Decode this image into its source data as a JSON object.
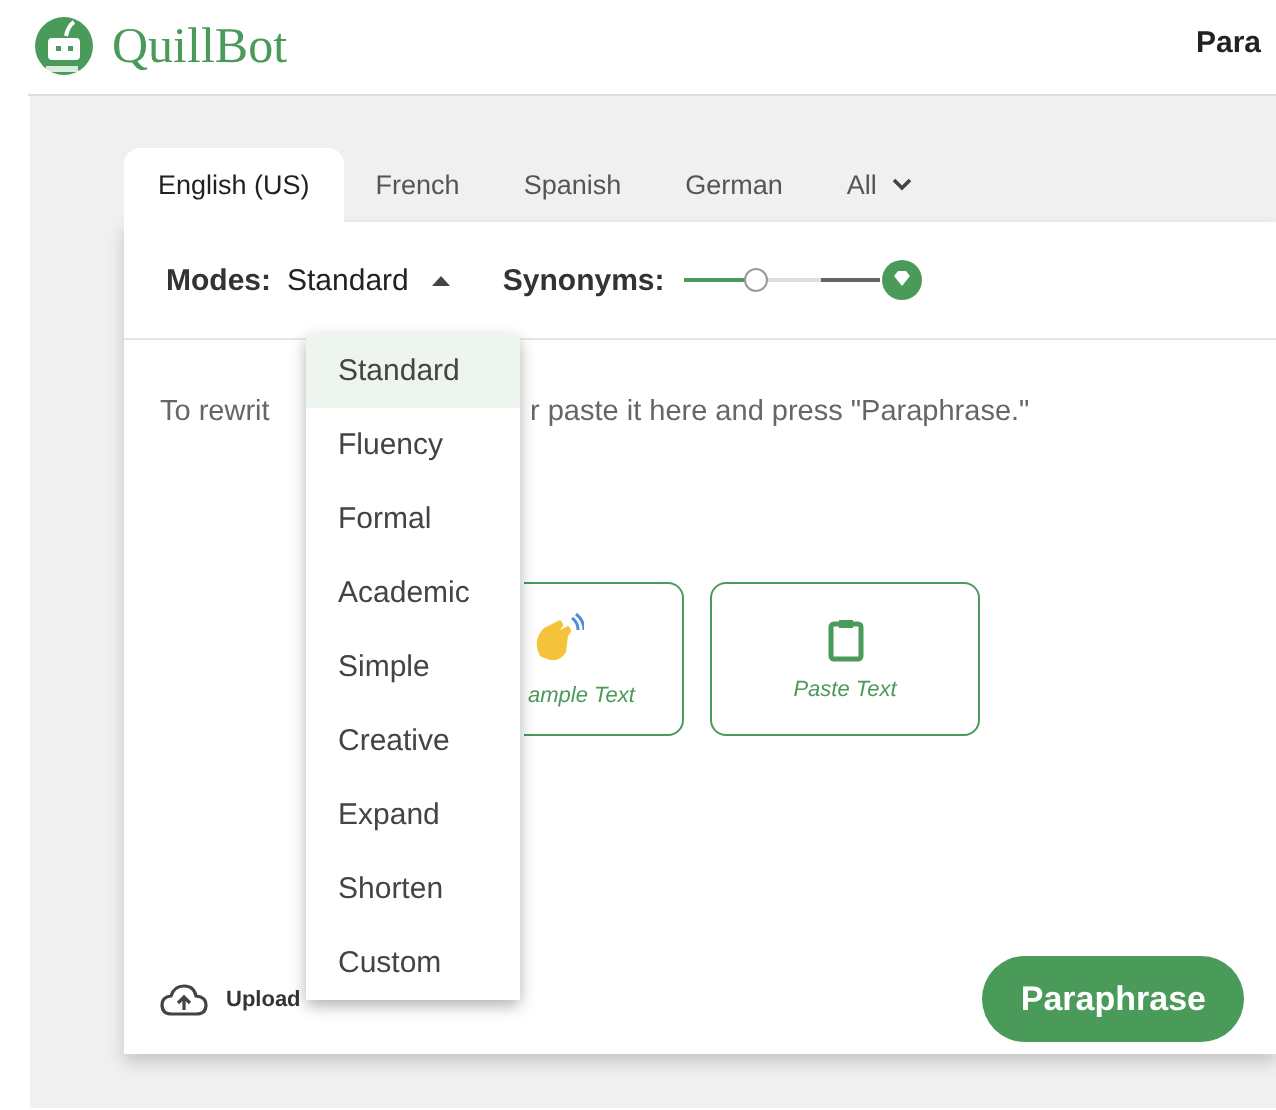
{
  "header": {
    "logo_text": "QuillBot",
    "nav_item": "Para"
  },
  "language_tabs": [
    {
      "label": "English (US)",
      "selected": true,
      "kind": "plain"
    },
    {
      "label": "French",
      "selected": false,
      "kind": "plain"
    },
    {
      "label": "Spanish",
      "selected": false,
      "kind": "plain"
    },
    {
      "label": "German",
      "selected": false,
      "kind": "plain"
    },
    {
      "label": "All",
      "selected": false,
      "kind": "dropdown"
    }
  ],
  "modes": {
    "label": "Modes:",
    "value": "Standard",
    "expanded": true
  },
  "synonyms": {
    "label": "Synonyms:",
    "level": 0.36
  },
  "editor": {
    "hint_before_menu": "To rewrit",
    "hint_after_menu": "r paste it here and press \"Paraphrase.\""
  },
  "input_buttons": [
    {
      "label": "ample Text",
      "kind": "sample"
    },
    {
      "label": "Paste Text",
      "kind": "paste"
    }
  ],
  "upload": {
    "label": "Upload"
  },
  "paraphrase_button": "Paraphrase",
  "mode_menu": [
    {
      "label": "Standard",
      "selected": true
    },
    {
      "label": "Fluency",
      "selected": false
    },
    {
      "label": "Formal",
      "selected": false
    },
    {
      "label": "Academic",
      "selected": false
    },
    {
      "label": "Simple",
      "selected": false
    },
    {
      "label": "Creative",
      "selected": false
    },
    {
      "label": "Expand",
      "selected": false
    },
    {
      "label": "Shorten",
      "selected": false
    },
    {
      "label": "Custom",
      "selected": false
    }
  ]
}
